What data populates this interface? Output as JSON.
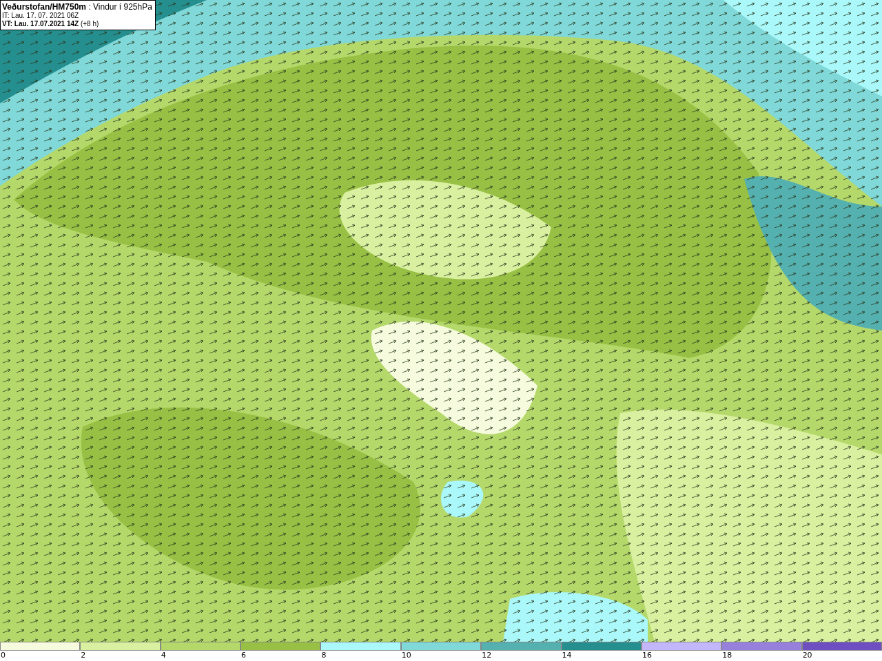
{
  "header": {
    "title": "**Veðurstofan/HM750m** : Vindur í 925hPa",
    "init_time": "IT: Lau. 17. 07. 2021 06Z",
    "valid_time": "**VT: Lau. 17.07.2021 14Z** (+8 h)"
  },
  "legend": {
    "bins": [
      {
        "color": "#f5fbdc",
        "label": "0"
      },
      {
        "color": "#d9f0a0",
        "label": "2"
      },
      {
        "color": "#b5d86a",
        "label": "4"
      },
      {
        "color": "#98c044",
        "label": "6"
      },
      {
        "color": "#aaf8fa",
        "label": "8"
      },
      {
        "color": "#80d8d8",
        "label": "10"
      },
      {
        "color": "#55b0b0",
        "label": "12"
      },
      {
        "color": "#258e8e",
        "label": "14"
      },
      {
        "color": "#c4b6fa",
        "label": "16"
      },
      {
        "color": "#9680dc",
        "label": "18"
      },
      {
        "color": "#6e4ec0",
        "label": "20"
      }
    ]
  }
}
